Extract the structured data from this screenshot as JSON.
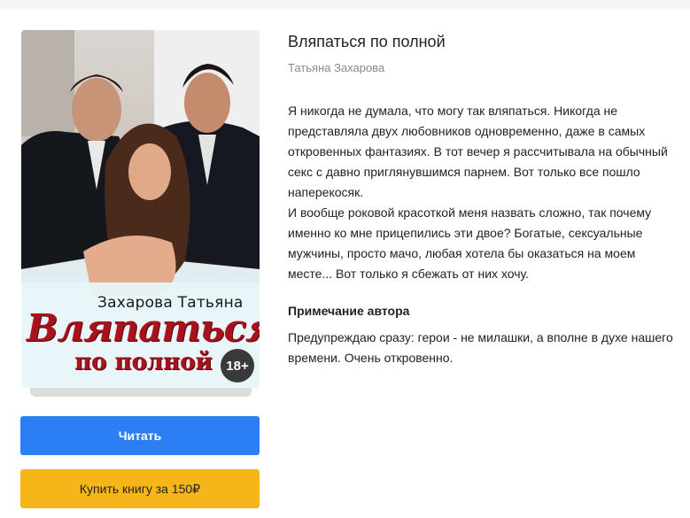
{
  "book": {
    "title": "Вляпаться по полной",
    "author": "Татьяна Захарова",
    "description": [
      "Я никогда не думала, что могу так вляпаться. Никогда не представляла двух любовников одновременно, даже в самых откровенных фантазиях. В тот вечер я рассчитывала на обычный секс с давно приглянувшимся парнем. Вот только все пошло наперекосяк.",
      "И вообще роковой красоткой меня назвать сложно, так почему именно ко мне прицепились эти двое? Богатые, сексуальные мужчины, просто мачо, любая хотела бы оказаться на моем месте... Вот только я сбежать от них хочу."
    ],
    "author_note": {
      "heading": "Примечание автора",
      "text": "Предупреждаю сразу: герои - не милашки, а вполне в духе нашего времени. Очень откровенно."
    }
  },
  "cover": {
    "author_text": "Захарова Татьяна",
    "title_line1": "Вляпаться",
    "title_line2": "по полной",
    "age_rating": "18+"
  },
  "actions": {
    "read_label": "Читать",
    "buy_label": "Купить книгу за 150₽"
  },
  "colors": {
    "read_button": "#2b7ef3",
    "buy_button": "#f6b619",
    "cover_title": "#a8121c"
  }
}
